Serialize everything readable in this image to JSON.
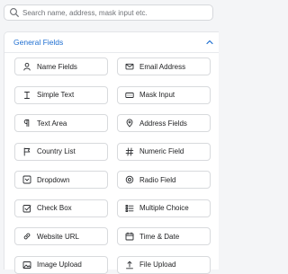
{
  "search": {
    "placeholder": "Search name, address, mask input etc."
  },
  "section": {
    "title": "General Fields",
    "accent": "#1f6fd1"
  },
  "fields": [
    {
      "label": "Name Fields",
      "icon": "user-icon"
    },
    {
      "label": "Email Address",
      "icon": "envelope-icon"
    },
    {
      "label": "Simple Text",
      "icon": "text-cursor-icon"
    },
    {
      "label": "Mask Input",
      "icon": "mask-input-icon"
    },
    {
      "label": "Text Area",
      "icon": "paragraph-icon"
    },
    {
      "label": "Address Fields",
      "icon": "map-pin-icon"
    },
    {
      "label": "Country List",
      "icon": "flag-icon"
    },
    {
      "label": "Numeric Field",
      "icon": "hash-icon"
    },
    {
      "label": "Dropdown",
      "icon": "dropdown-icon"
    },
    {
      "label": "Radio Field",
      "icon": "radio-icon"
    },
    {
      "label": "Check Box",
      "icon": "checkbox-icon"
    },
    {
      "label": "Multiple Choice",
      "icon": "list-icon"
    },
    {
      "label": "Website URL",
      "icon": "link-icon"
    },
    {
      "label": "Time & Date",
      "icon": "calendar-icon"
    },
    {
      "label": "Image Upload",
      "icon": "image-upload-icon"
    },
    {
      "label": "File Upload",
      "icon": "file-upload-icon"
    }
  ]
}
